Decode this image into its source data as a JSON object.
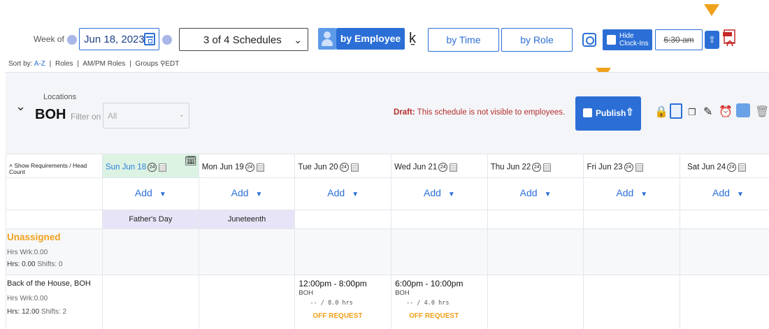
{
  "toolbar": {
    "week_of_label": "Week of",
    "week_date": "Jun 18, 2023",
    "schedules_select": "3 of 4 Schedules",
    "view_by_employee": "by Employee",
    "view_by_time": "by Time",
    "view_by_role": "by Role",
    "hide_clock_ins_line1": "Hide",
    "hide_clock_ins_line2": "Clock-Ins",
    "time_toggle": "6:30 am",
    "icons": [
      "calendar-icon",
      "people-icon",
      "walking-icon",
      "zoom-icon",
      "upload-icon",
      "pdf-icon"
    ],
    "accent_color": "#2b6fd6",
    "highlight_color": "#f0a11c"
  },
  "sort_bar": {
    "label": "Sort by:",
    "options": [
      "A-Z",
      "Roles",
      "AM/PM Roles",
      "Groups"
    ],
    "timezone": "EDT"
  },
  "location": {
    "label": "Locations",
    "name": "BOH",
    "filter_label": "Filter on",
    "filter_value": "All",
    "draft_label": "Draft:",
    "draft_message": "This schedule is not visible to employees.",
    "publish_label": "Publish"
  },
  "grid": {
    "requirements_toggle": "Show Requirements / Head Count",
    "badge": "24",
    "days": [
      {
        "label": "Sun Jun 18",
        "holiday": "Father's Day"
      },
      {
        "label": "Mon Jun 19",
        "holiday": "Juneteenth"
      },
      {
        "label": "Tue Jun 20",
        "holiday": ""
      },
      {
        "label": "Wed Jun 21",
        "holiday": ""
      },
      {
        "label": "Thu Jun 22",
        "holiday": ""
      },
      {
        "label": "Fri Jun 23",
        "holiday": ""
      },
      {
        "label": "Sat Jun 24",
        "holiday": ""
      }
    ],
    "add_label": "Add",
    "rows": [
      {
        "title": "Unassigned",
        "hrs_wrk": "Hrs Wrk:0.00",
        "hrs": "Hrs: 0.00",
        "shifts": "Shifts: 0"
      },
      {
        "title": "Back of the House, BOH",
        "hrs_wrk": "Hrs Wrk:0.00",
        "hrs": "Hrs: 12.00",
        "shifts": "Shifts: 2",
        "shifts_by_day": {
          "tue": {
            "time": "12:00pm - 8:00pm",
            "location": "BOH",
            "hours": "-- / 8.0 hrs",
            "status": "OFF REQUEST"
          },
          "wed": {
            "time": "6:00pm - 10:00pm",
            "location": "BOH",
            "hours": "-- / 4.0 hrs",
            "status": "OFF REQUEST"
          }
        }
      }
    ]
  }
}
